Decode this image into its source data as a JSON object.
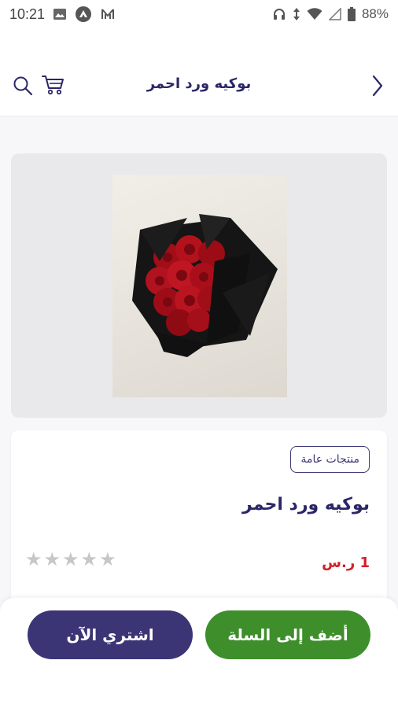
{
  "status_bar": {
    "time": "10:21",
    "battery": "88%"
  },
  "header": {
    "title": "بوكيه ورد احمر"
  },
  "product": {
    "category": "منتجات عامة",
    "name": "بوكيه ورد احمر",
    "price": "1 ر.س",
    "rating": {
      "value": 0,
      "max": 5
    }
  },
  "actions": {
    "add_to_cart": "أضف إلى السلة",
    "buy_now": "اشتري الآن"
  },
  "colors": {
    "brand": "#2a2667",
    "price": "#d0202a",
    "add_button": "#3e8e2b",
    "buy_button": "#3b3575"
  }
}
